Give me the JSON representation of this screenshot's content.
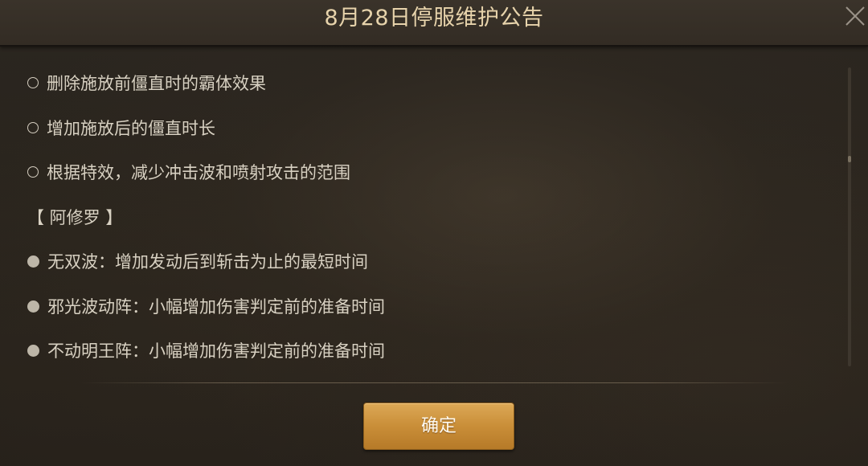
{
  "dialog": {
    "title": "8月28日停服维护公告",
    "close_icon": "close-icon"
  },
  "content": {
    "lines": [
      {
        "bullet": "hollow-circle",
        "text": "删除施放前僵直时的霸体效果"
      },
      {
        "bullet": "hollow-circle",
        "text": "增加施放后的僵直时长"
      },
      {
        "bullet": "hollow-circle",
        "text": "根据特效，减少冲击波和喷射攻击的范围"
      },
      {
        "bullet": "none",
        "text": "【 阿修罗 】"
      },
      {
        "bullet": "filled-circle",
        "text": "无双波：增加发动后到斩击为止的最短时间"
      },
      {
        "bullet": "filled-circle",
        "text": "邪光波动阵：小幅增加伤害判定前的准备时间"
      },
      {
        "bullet": "filled-circle",
        "text": "不动明王阵：小幅增加伤害判定前的准备时间"
      }
    ]
  },
  "footer": {
    "confirm_label": "确定"
  },
  "colors": {
    "title_text": "#e7d3ab",
    "body_text": "#d8d1c2",
    "button_gold": "#c98e38",
    "panel_bg": "#29241d"
  }
}
